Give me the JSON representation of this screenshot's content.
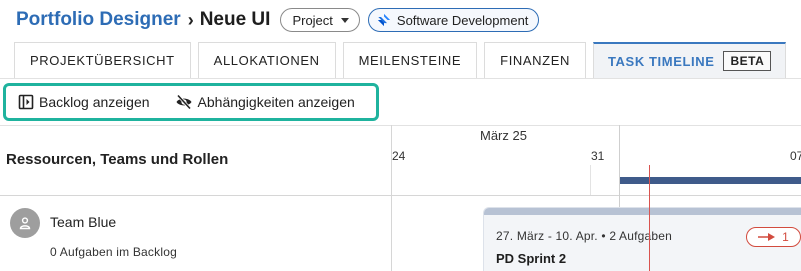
{
  "header": {
    "app_title": "Portfolio Designer",
    "separator": "›",
    "page_title": "Neue UI",
    "type_select": "Project",
    "project_badge": "Software Development"
  },
  "tabs": [
    {
      "label": "PROJEKTÜBERSICHT"
    },
    {
      "label": "ALLOKATIONEN"
    },
    {
      "label": "MEILENSTEINE"
    },
    {
      "label": "FINANZEN"
    },
    {
      "label": "TASK TIMELINE",
      "badge": "BETA",
      "active": true
    }
  ],
  "toolbar": {
    "backlog_label": "Backlog anzeigen",
    "dependencies_label": "Abhängigkeiten anzeigen"
  },
  "grid": {
    "resources_title": "Ressourcen, Teams und Rollen",
    "month_label": "März 25",
    "days": [
      "24",
      "31",
      "07"
    ]
  },
  "team": {
    "name": "Team Blue",
    "backlog_text": "0 Aufgaben im Backlog"
  },
  "sprint": {
    "dates": "27. März - 10. Apr. • 2 Aufgaben",
    "name": "PD Sprint 2",
    "dependency_count": "1"
  },
  "colors": {
    "accent": "#2d6cb5",
    "active_tab": "#3a78bf",
    "highlight": "#1fb39e",
    "summary_bar": "#3f5b8a",
    "today_line": "#d9534f",
    "dependency": "#d24b3e"
  }
}
